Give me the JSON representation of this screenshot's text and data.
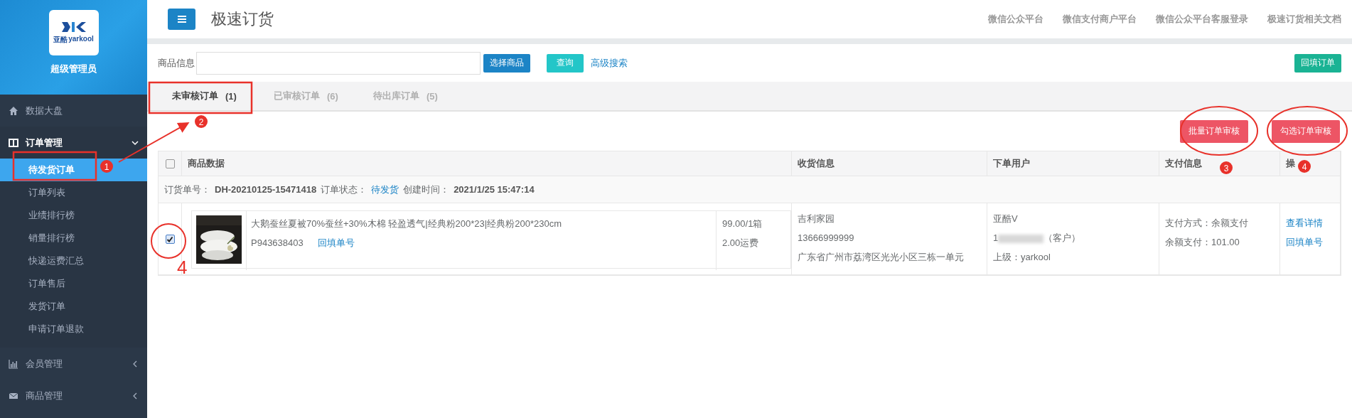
{
  "sidebar": {
    "logo": {
      "cn": "亚酷",
      "en": "yarkool"
    },
    "role": "超级管理员",
    "menu": [
      {
        "kind": "link",
        "label": "数据大盘"
      },
      {
        "kind": "group",
        "label": "订单管理",
        "expanded": true,
        "children": [
          {
            "label": "待发货订单",
            "selected": true
          },
          {
            "label": "订单列表",
            "selected": false
          },
          {
            "label": "业绩排行榜",
            "selected": false
          },
          {
            "label": "销量排行榜",
            "selected": false
          },
          {
            "label": "快递运费汇总",
            "selected": false
          },
          {
            "label": "订单售后",
            "selected": false
          },
          {
            "label": "发货订单",
            "selected": false
          },
          {
            "label": "申请订单退款",
            "selected": false
          }
        ]
      },
      {
        "kind": "group",
        "label": "会员管理",
        "expanded": false
      },
      {
        "kind": "group",
        "label": "商品管理",
        "expanded": false
      }
    ]
  },
  "topbar": {
    "title": "极速订货",
    "links": [
      "微信公众平台",
      "微信支付商户平台",
      "微信公众平台客服登录",
      "极速订货相关文档"
    ]
  },
  "search": {
    "label": "商品信息",
    "select_button": "选择商品",
    "query_button": "查询",
    "advanced_link": "高级搜索",
    "backfill_button": "回填订单"
  },
  "tabs": [
    {
      "label": "未审核订单",
      "count": "(1)",
      "selected": true
    },
    {
      "label": "已审核订单",
      "count": "(6)",
      "selected": false
    },
    {
      "label": "待出库订单",
      "count": "(5)",
      "selected": false
    }
  ],
  "actions": [
    "批量订单审核",
    "勾选订单审核"
  ],
  "table": {
    "select_all_checked": false,
    "columns": [
      "商品数据",
      "收货信息",
      "下单用户",
      "支付信息",
      "操"
    ],
    "orders": [
      {
        "order_no_label": "订货单号：",
        "order_no": "DH-20210125-15471418",
        "status_label": "订单状态：",
        "status": "待发货",
        "created_label": "创建时间：",
        "created": "2021/1/25 15:47:14",
        "checked": true,
        "product": {
          "name": "大鹅蚕丝夏被70%蚕丝+30%木棉 轻盈透气|经典粉200*23|经典粉200*230cm",
          "code": "P943638403",
          "code_link": "回填单号",
          "price": "99.00/1箱",
          "shipping": "2.00运费"
        },
        "recipient": {
          "name": "吉利家园",
          "phone": "13666999999",
          "address": "广东省广州市荔湾区光光小区三栋一单元"
        },
        "user": {
          "name": "亚酷V",
          "phone_start": "1",
          "role": "（客户）",
          "parent": "上级：yarkool"
        },
        "payment": {
          "method": "支付方式：余额支付",
          "amount": "余额支付：101.00"
        },
        "ops": [
          "查看详情",
          "回填单号"
        ]
      }
    ]
  },
  "annotations": {
    "badges": [
      "1",
      "2",
      "3",
      "4"
    ],
    "handwritten": "4"
  }
}
